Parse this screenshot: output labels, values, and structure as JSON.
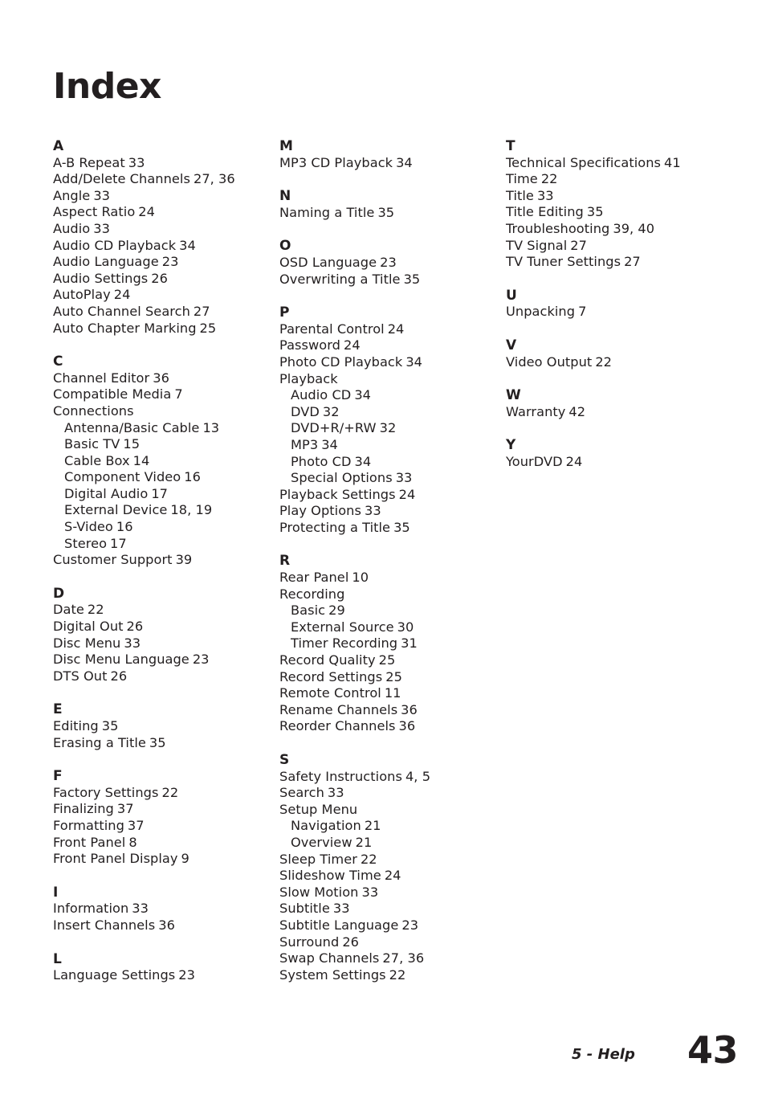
{
  "document": {
    "title": "Index",
    "page_number": "43",
    "footer_label": "5 - Help",
    "text_color": "#231f20",
    "background_color": "#ffffff"
  },
  "columns": [
    {
      "id": "column-1",
      "sections": [
        {
          "letter": "A",
          "entries": [
            {
              "label": "A-B Repeat",
              "pages": "33",
              "sub": false
            },
            {
              "label": "Add/Delete Channels",
              "pages": "27, 36",
              "sub": false
            },
            {
              "label": "Angle",
              "pages": "33",
              "sub": false
            },
            {
              "label": "Aspect Ratio",
              "pages": "24",
              "sub": false
            },
            {
              "label": "Audio",
              "pages": "33",
              "sub": false
            },
            {
              "label": "Audio CD Playback",
              "pages": "34",
              "sub": false
            },
            {
              "label": "Audio Language",
              "pages": "23",
              "sub": false
            },
            {
              "label": "Audio Settings",
              "pages": "26",
              "sub": false
            },
            {
              "label": "AutoPlay",
              "pages": "24",
              "sub": false
            },
            {
              "label": "Auto Channel Search",
              "pages": "27",
              "sub": false
            },
            {
              "label": "Auto Chapter Marking",
              "pages": "25",
              "sub": false
            }
          ]
        },
        {
          "letter": "C",
          "entries": [
            {
              "label": "Channel Editor",
              "pages": "36",
              "sub": false
            },
            {
              "label": "Compatible Media",
              "pages": "7",
              "sub": false
            },
            {
              "label": "Connections",
              "pages": "",
              "sub": false
            },
            {
              "label": "Antenna/Basic Cable",
              "pages": "13",
              "sub": true
            },
            {
              "label": "Basic TV",
              "pages": "15",
              "sub": true
            },
            {
              "label": "Cable Box",
              "pages": "14",
              "sub": true
            },
            {
              "label": "Component Video",
              "pages": "16",
              "sub": true
            },
            {
              "label": "Digital Audio",
              "pages": "17",
              "sub": true
            },
            {
              "label": "External Device",
              "pages": "18, 19",
              "sub": true
            },
            {
              "label": "S-Video",
              "pages": "16",
              "sub": true
            },
            {
              "label": "Stereo",
              "pages": "17",
              "sub": true
            },
            {
              "label": "Customer Support",
              "pages": "39",
              "sub": false
            }
          ]
        },
        {
          "letter": "D",
          "entries": [
            {
              "label": "Date",
              "pages": "22",
              "sub": false
            },
            {
              "label": "Digital Out",
              "pages": "26",
              "sub": false
            },
            {
              "label": "Disc Menu",
              "pages": "33",
              "sub": false
            },
            {
              "label": "Disc Menu Language",
              "pages": "23",
              "sub": false
            },
            {
              "label": "DTS Out",
              "pages": "26",
              "sub": false
            }
          ]
        },
        {
          "letter": "E",
          "entries": [
            {
              "label": "Editing",
              "pages": "35",
              "sub": false
            },
            {
              "label": "Erasing a Title",
              "pages": "35",
              "sub": false
            }
          ]
        },
        {
          "letter": "F",
          "entries": [
            {
              "label": "Factory Settings",
              "pages": "22",
              "sub": false
            },
            {
              "label": "Finalizing",
              "pages": "37",
              "sub": false
            },
            {
              "label": "Formatting",
              "pages": "37",
              "sub": false
            },
            {
              "label": "Front Panel",
              "pages": "8",
              "sub": false
            },
            {
              "label": "Front Panel Display",
              "pages": "9",
              "sub": false
            }
          ]
        },
        {
          "letter": "I",
          "entries": [
            {
              "label": "Information",
              "pages": "33",
              "sub": false
            },
            {
              "label": "Insert Channels",
              "pages": "36",
              "sub": false
            }
          ]
        },
        {
          "letter": "L",
          "entries": [
            {
              "label": "Language Settings",
              "pages": "23",
              "sub": false
            }
          ]
        }
      ]
    },
    {
      "id": "column-2",
      "sections": [
        {
          "letter": "M",
          "entries": [
            {
              "label": "MP3 CD Playback",
              "pages": "34",
              "sub": false
            }
          ]
        },
        {
          "letter": "N",
          "entries": [
            {
              "label": "Naming a Title",
              "pages": "35",
              "sub": false
            }
          ]
        },
        {
          "letter": "O",
          "entries": [
            {
              "label": "OSD Language",
              "pages": "23",
              "sub": false
            },
            {
              "label": "Overwriting a Title",
              "pages": "35",
              "sub": false
            }
          ]
        },
        {
          "letter": "P",
          "entries": [
            {
              "label": "Parental Control",
              "pages": "24",
              "sub": false
            },
            {
              "label": "Password",
              "pages": "24",
              "sub": false
            },
            {
              "label": "Photo CD Playback",
              "pages": "34",
              "sub": false
            },
            {
              "label": "Playback",
              "pages": "",
              "sub": false
            },
            {
              "label": "Audio CD",
              "pages": "34",
              "sub": true
            },
            {
              "label": "DVD",
              "pages": "32",
              "sub": true
            },
            {
              "label": "DVD+R/+RW",
              "pages": "32",
              "sub": true
            },
            {
              "label": "MP3",
              "pages": "34",
              "sub": true
            },
            {
              "label": "Photo CD",
              "pages": "34",
              "sub": true
            },
            {
              "label": "Special Options",
              "pages": "33",
              "sub": true
            },
            {
              "label": "Playback Settings",
              "pages": "24",
              "sub": false
            },
            {
              "label": "Play Options",
              "pages": "33",
              "sub": false
            },
            {
              "label": "Protecting a Title",
              "pages": "35",
              "sub": false
            }
          ]
        },
        {
          "letter": "R",
          "entries": [
            {
              "label": "Rear Panel",
              "pages": "10",
              "sub": false
            },
            {
              "label": "Recording",
              "pages": "",
              "sub": false
            },
            {
              "label": "Basic",
              "pages": "29",
              "sub": true
            },
            {
              "label": "External Source",
              "pages": "30",
              "sub": true
            },
            {
              "label": "Timer Recording",
              "pages": "31",
              "sub": true
            },
            {
              "label": "Record Quality",
              "pages": "25",
              "sub": false
            },
            {
              "label": "Record Settings",
              "pages": "25",
              "sub": false
            },
            {
              "label": "Remote Control",
              "pages": "11",
              "sub": false
            },
            {
              "label": "Rename Channels",
              "pages": "36",
              "sub": false
            },
            {
              "label": "Reorder Channels",
              "pages": "36",
              "sub": false
            }
          ]
        },
        {
          "letter": "S",
          "entries": [
            {
              "label": "Safety Instructions",
              "pages": "4, 5",
              "sub": false
            },
            {
              "label": "Search",
              "pages": "33",
              "sub": false
            },
            {
              "label": "Setup Menu",
              "pages": "",
              "sub": false
            },
            {
              "label": "Navigation",
              "pages": "21",
              "sub": true
            },
            {
              "label": "Overview",
              "pages": "21",
              "sub": true
            },
            {
              "label": "Sleep Timer",
              "pages": "22",
              "sub": false
            },
            {
              "label": "Slideshow Time",
              "pages": "24",
              "sub": false
            },
            {
              "label": "Slow Motion",
              "pages": "33",
              "sub": false
            },
            {
              "label": "Subtitle",
              "pages": "33",
              "sub": false
            },
            {
              "label": "Subtitle Language",
              "pages": "23",
              "sub": false
            },
            {
              "label": "Surround",
              "pages": "26",
              "sub": false
            },
            {
              "label": "Swap Channels",
              "pages": "27, 36",
              "sub": false
            },
            {
              "label": "System Settings",
              "pages": "22",
              "sub": false
            }
          ]
        }
      ]
    },
    {
      "id": "column-3",
      "sections": [
        {
          "letter": "T",
          "entries": [
            {
              "label": "Technical Specifications",
              "pages": "41",
              "sub": false
            },
            {
              "label": "Time",
              "pages": "22",
              "sub": false
            },
            {
              "label": "Title",
              "pages": "33",
              "sub": false
            },
            {
              "label": "Title Editing",
              "pages": "35",
              "sub": false
            },
            {
              "label": "Troubleshooting",
              "pages": "39, 40",
              "sub": false
            },
            {
              "label": "TV Signal",
              "pages": "27",
              "sub": false
            },
            {
              "label": "TV Tuner Settings",
              "pages": "27",
              "sub": false
            }
          ]
        },
        {
          "letter": "U",
          "entries": [
            {
              "label": "Unpacking",
              "pages": "7",
              "sub": false
            }
          ]
        },
        {
          "letter": "V",
          "entries": [
            {
              "label": "Video Output",
              "pages": "22",
              "sub": false
            }
          ]
        },
        {
          "letter": "W",
          "entries": [
            {
              "label": "Warranty",
              "pages": "42",
              "sub": false
            }
          ]
        },
        {
          "letter": "Y",
          "entries": [
            {
              "label": "YourDVD",
              "pages": "24",
              "sub": false
            }
          ]
        }
      ]
    }
  ]
}
